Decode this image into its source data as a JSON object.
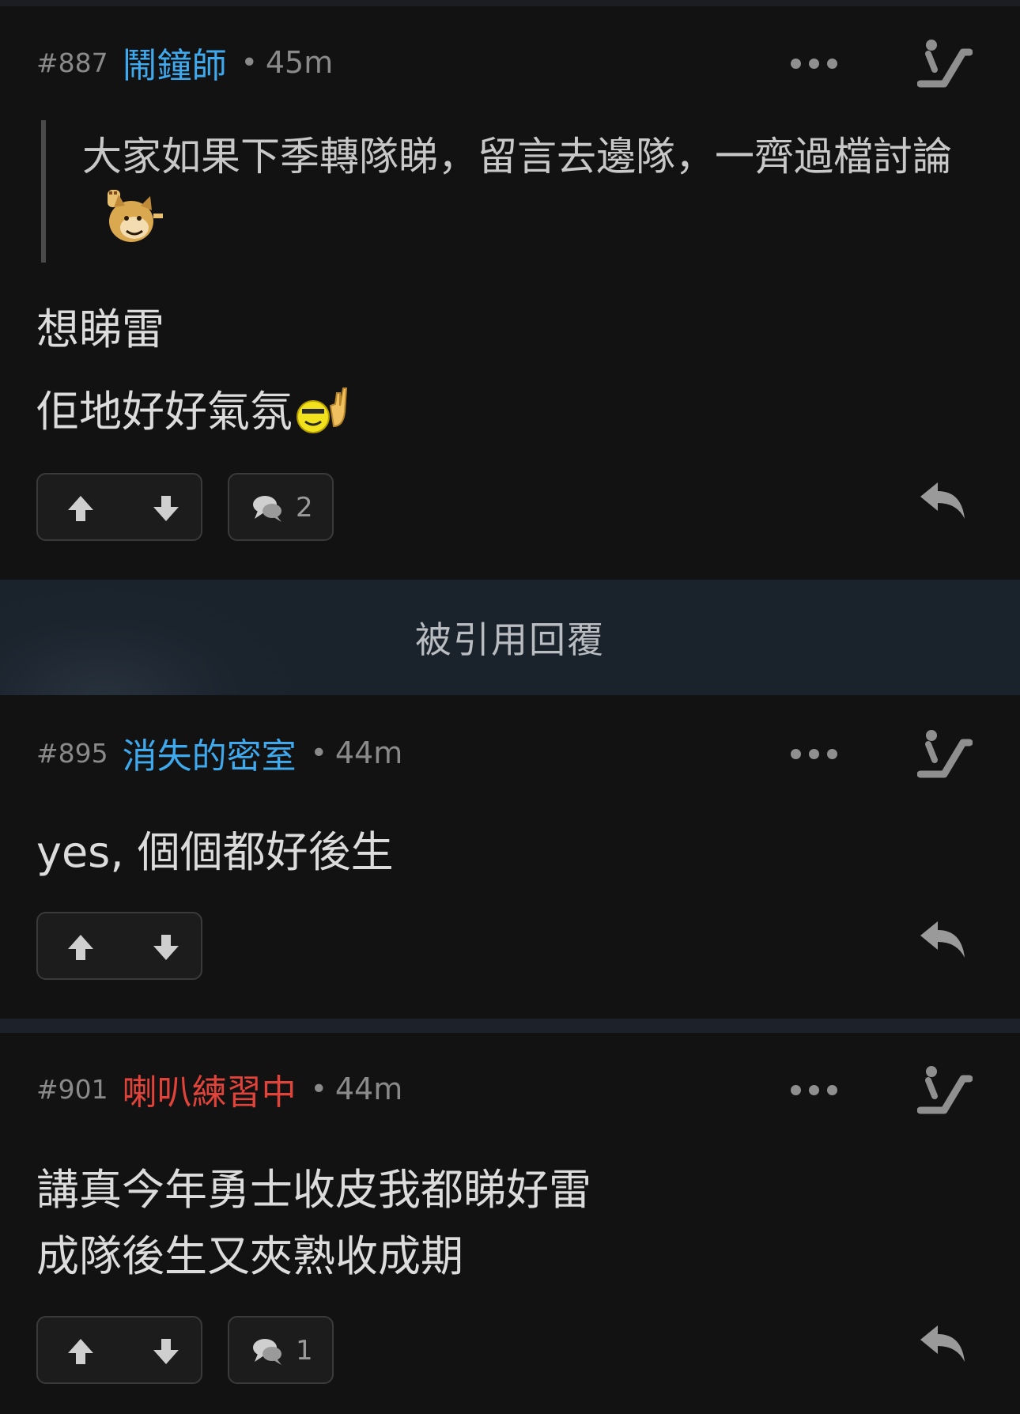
{
  "posts": [
    {
      "floor": "#887",
      "username": "鬧鐘師",
      "separator": "•",
      "time": "45m",
      "quote_text": "大家如果下季轉隊睇，留言去邊隊，一齊過檔討論",
      "quote_sticker": "doge-wave-sticker",
      "lines": [
        "想睇雷",
        "佢地好好氣氛"
      ],
      "line_sticker": "rock-on-smiley-sticker",
      "reply_count": "2"
    },
    {
      "floor": "#895",
      "username": "消失的密室",
      "separator": "•",
      "time": "44m",
      "lines": [
        "yes, 個個都好後生"
      ]
    },
    {
      "floor": "#901",
      "username": "喇叭練習中",
      "separator": "•",
      "time": "44m",
      "lines": [
        "講真今年勇士收皮我都睇好雷",
        "成隊後生又夾熟收成期"
      ],
      "reply_count": "1"
    }
  ],
  "quoted_replies_banner": "被引用回覆",
  "colors": {
    "background": "#121212",
    "username_blue": "#3fa9ee",
    "username_red": "#e0433a",
    "muted": "#8a8a8a",
    "banner_bg": "#1b232d"
  },
  "icons": [
    "more-icon",
    "escalator-icon",
    "upvote-icon",
    "downvote-icon",
    "comment-icon",
    "reply-icon"
  ]
}
